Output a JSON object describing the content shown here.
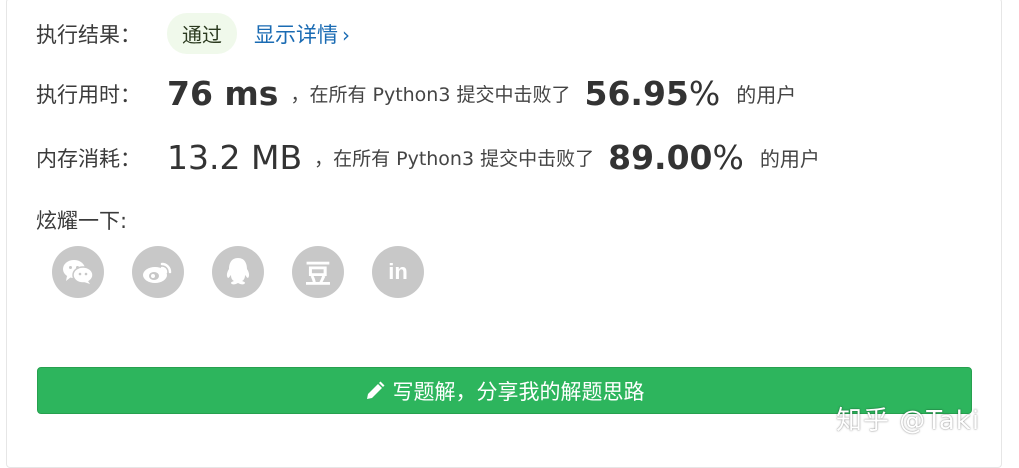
{
  "result": {
    "label": "执行结果：",
    "status": "通过",
    "detail_link": "显示详情",
    "chevron": "›"
  },
  "runtime": {
    "label": "执行用时：",
    "value": "76 ms",
    "prefix": "，在所有 Python3 提交中击败了",
    "percent": "56.95",
    "percent_sign": "%",
    "suffix": "的用户"
  },
  "memory": {
    "label": "内存消耗：",
    "value": "13.2 MB",
    "prefix": "，在所有 Python3 提交中击败了",
    "percent": "89.00",
    "percent_sign": "%",
    "suffix": "的用户"
  },
  "share": {
    "label": "炫耀一下:",
    "icons": [
      "wechat-icon",
      "weibo-icon",
      "qq-icon",
      "douban-icon",
      "linkedin-icon"
    ],
    "douban_glyph": "豆",
    "linkedin_glyph": "in"
  },
  "solution_button": {
    "label": "写题解，分享我的解题思路",
    "icon": "pencil-icon"
  },
  "watermark": "知乎 @Taki",
  "colors": {
    "accent_green": "#2db55d",
    "badge_bg": "#f0f9eb",
    "link_blue": "#1a6bb3",
    "icon_gray": "#c8c8c8"
  }
}
